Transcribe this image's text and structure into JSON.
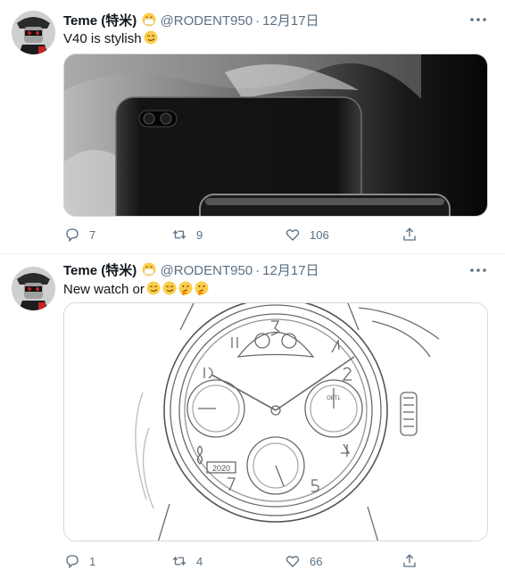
{
  "tweets": [
    {
      "name": "Teme (特米)",
      "handle": "@RODENT950",
      "date": "12月17日",
      "text": "V40 is stylish",
      "emojis_after_text": [
        "smirk-emoji"
      ],
      "counts": {
        "reply": "7",
        "retweet": "9",
        "like": "106"
      }
    },
    {
      "name": "Teme (特米)",
      "handle": "@RODENT950",
      "date": "12月17日",
      "text": "New watch or",
      "emojis_after_text": [
        "smirk-emoji",
        "smirk-emoji",
        "thinking-emoji",
        "thinking-emoji"
      ],
      "counts": {
        "reply": "1",
        "retweet": "4",
        "like": "66"
      },
      "media_labels": {
        "year": "2020",
        "subdial_logo": "OBTL"
      }
    }
  ],
  "colors": {
    "secondary_text": "#5b7083",
    "border": "#cfd9de",
    "divider": "#e6ecf0"
  }
}
